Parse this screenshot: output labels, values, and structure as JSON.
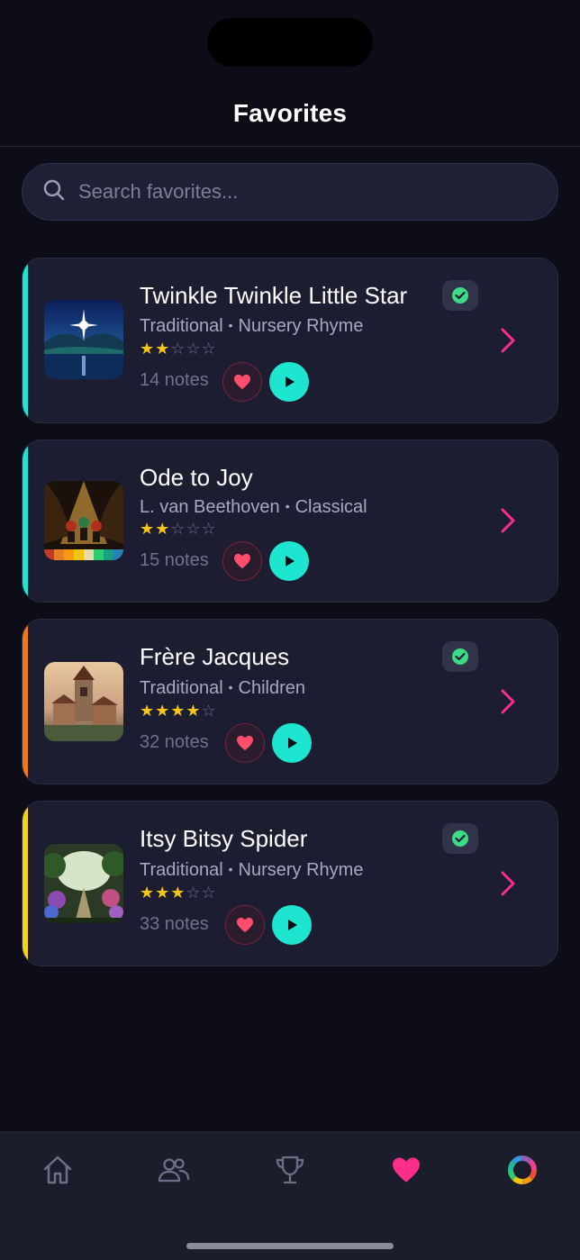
{
  "header": {
    "title": "Favorites"
  },
  "search": {
    "placeholder": "Search favorites..."
  },
  "cards": [
    {
      "title": "Twinkle Twinkle Little Star",
      "composer": "Traditional",
      "genre": "Nursery Rhyme",
      "stars": "★★",
      "stars_off": "☆☆☆",
      "rating": 2,
      "notes": "14 notes",
      "completed": true,
      "accent": "#1de5cf"
    },
    {
      "title": "Ode to Joy",
      "composer": "L. van Beethoven",
      "genre": "Classical",
      "stars": "★★",
      "stars_off": "☆☆☆",
      "rating": 2,
      "notes": "15 notes",
      "completed": false,
      "accent": "#1de5cf"
    },
    {
      "title": "Frère Jacques",
      "composer": "Traditional",
      "genre": "Children",
      "stars": "★★★★",
      "stars_off": "☆",
      "rating": 4,
      "notes": "32 notes",
      "completed": true,
      "accent": "#f07a12"
    },
    {
      "title": "Itsy Bitsy Spider",
      "composer": "Traditional",
      "genre": "Nursery Rhyme",
      "stars": "★★★",
      "stars_off": "☆☆",
      "rating": 3,
      "notes": "33 notes",
      "completed": true,
      "accent": "#f5d21a"
    }
  ],
  "tabbar": {
    "items": [
      "home-icon",
      "people-icon",
      "trophy-icon",
      "heart-icon",
      "color-wheel-icon"
    ],
    "active": "heart-icon",
    "active_color": "#ff2d8a"
  },
  "colors": {
    "background": "#0c0d17",
    "card": "#1c1d30",
    "teal": "#1de5cf",
    "pink": "#ff2d8a",
    "heart": "#ff4d6d",
    "check": "#3ddc84"
  }
}
